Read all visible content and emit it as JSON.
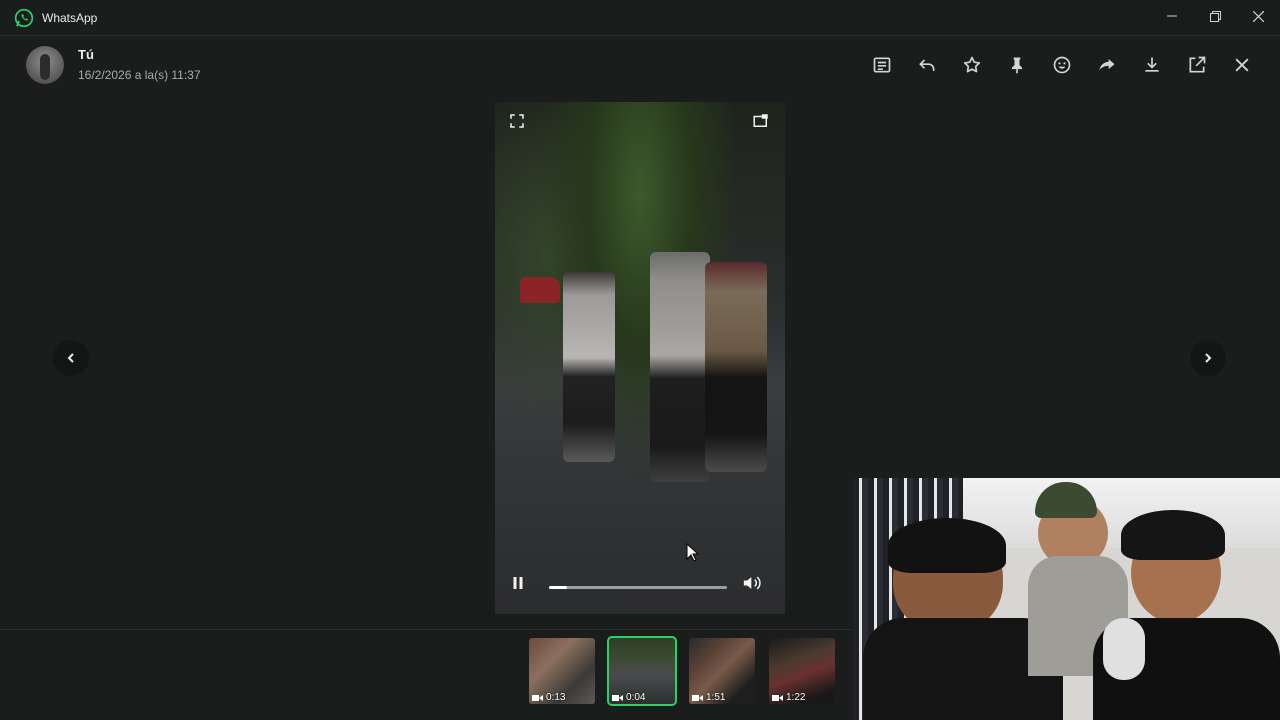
{
  "window": {
    "title": "WhatsApp",
    "controls": [
      "minimize",
      "restore",
      "close"
    ]
  },
  "header": {
    "sender": "Tú",
    "timestamp": "16/2/2026 a la(s) 11:37",
    "actions": [
      {
        "name": "caption",
        "icon": "message-text-icon"
      },
      {
        "name": "reply",
        "icon": "reply-icon"
      },
      {
        "name": "star",
        "icon": "star-icon"
      },
      {
        "name": "pin",
        "icon": "pin-icon"
      },
      {
        "name": "react",
        "icon": "emoji-icon"
      },
      {
        "name": "forward",
        "icon": "forward-icon"
      },
      {
        "name": "download",
        "icon": "download-icon"
      },
      {
        "name": "open-external",
        "icon": "open-external-icon"
      },
      {
        "name": "close",
        "icon": "close-icon"
      }
    ]
  },
  "player": {
    "state": "playing",
    "progress": 0.1,
    "volume_icon": "volume-icon"
  },
  "thumbnails": [
    {
      "duration": "0:13",
      "selected": false
    },
    {
      "duration": "0:04",
      "selected": true
    },
    {
      "duration": "1:51",
      "selected": false
    },
    {
      "duration": "1:22",
      "selected": false
    }
  ],
  "colors": {
    "accent": "#25d366",
    "background": "#1b1c1c",
    "text": "#e9edef",
    "muted": "#a7aeb1"
  }
}
